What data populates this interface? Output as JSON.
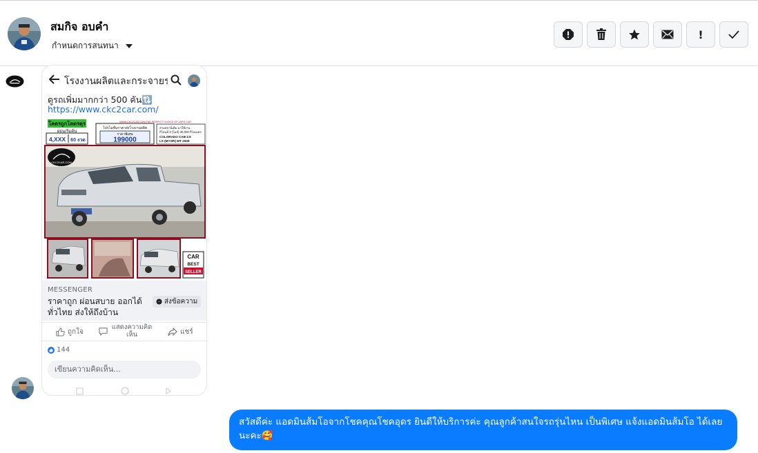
{
  "header": {
    "contact_name": "สมกิจ อบคำ",
    "label_dropdown": "กำหนดการสนทนา"
  },
  "actions": [
    {
      "name": "report-icon",
      "label": "!"
    },
    {
      "name": "trash-icon",
      "label": ""
    },
    {
      "name": "star-icon",
      "label": ""
    },
    {
      "name": "envelope-icon",
      "label": ""
    },
    {
      "name": "follow-up-icon",
      "label": "!"
    },
    {
      "name": "check-icon",
      "label": ""
    }
  ],
  "shared_post": {
    "page_title": "โรงงานผลิตและกระจายร...",
    "post_text": "ดูรถเพิ่มมากกว่า 500 คัน🔃",
    "post_link": "https://www.ckc2car.com/",
    "ad": {
      "banner_left": "โคตรถูกโคตรดุร",
      "sub_left": "ผ่อนเริ่มต้น",
      "installment": "4,XXX",
      "months": "60 งวด",
      "site": "WWW.CKC2CAR.COM  THE PERFECT CHOICE OF USED CAR",
      "price_title": "โปรโมชั่นราคาส่งโรงงานผลิต",
      "price_label": "ราคาพิเศษ",
      "price": "199000",
      "spec_line1": "สามสถานีเดิม มาใช้งาน",
      "spec_line2": "กิโลแท้ 3 (ไมล์) 30,000 กิโลเมตร",
      "model": "COLORADO CAB 2.5",
      "model2": "LS (MYOR) MT 2009",
      "logo_text": "CKC2CAR.COM",
      "badge1": "CAR",
      "badge2": "BEST",
      "badge3": "SELLER"
    },
    "source": "MESSENGER",
    "headline": "ราคาถูก ผ่อนสบาย ออกได้ทั่วไทย ส่งให้ถึงบ้าน",
    "send_label": "ส่งข้อความ",
    "like_label": "ถูกใจ",
    "comment_label": "แสดงความคิดเห็น",
    "share_label": "แชร์",
    "like_count": "144",
    "comment_placeholder": "เขียนความคิดเห็น..."
  },
  "reply": {
    "text": "สวัสดีค่ะ แอดมินส้มโอจากโชคคุณโชคอุดร ยินดีให้บริการค่ะ  คุณลูกค้าสนใจรถรุ่นไหน เป็นพิเศษ แจ้งแอดมินส้มโอ ได้เลยนะคะ🥰"
  },
  "colors": {
    "bubble": "#0a7cff",
    "link": "#216fdb",
    "ad_green": "#2fbf2f",
    "ad_red": "#c8102e",
    "ad_blue": "#1a3fa0"
  }
}
